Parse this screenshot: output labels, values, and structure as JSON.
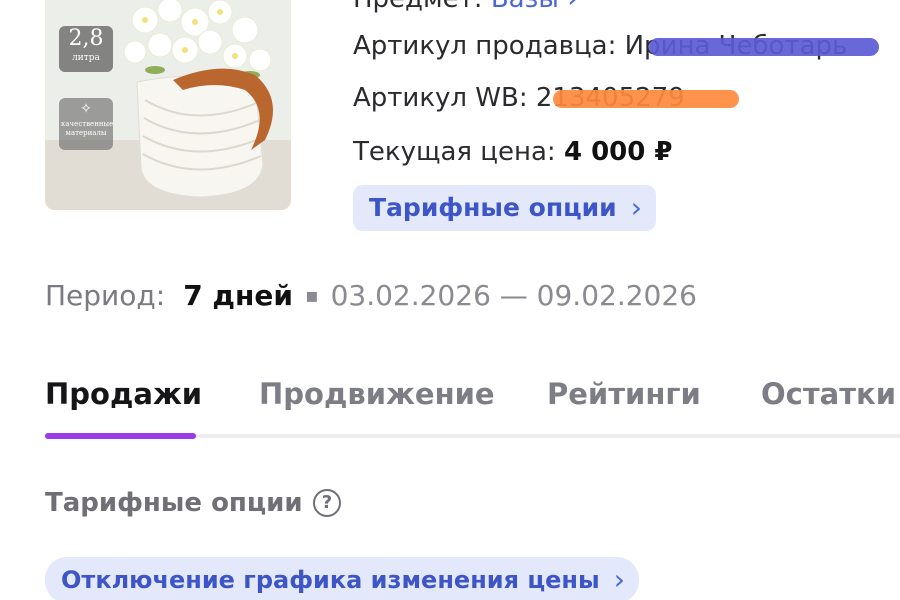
{
  "product": {
    "volume": "2,8",
    "volume_unit": "литра",
    "quality_label": "качественные материалы"
  },
  "info": {
    "subject_label": "Предмет:",
    "subject_value": "Вазы",
    "seller_article_label": "Артикул продавца:",
    "seller_article_value": "Ирина Чеботарь",
    "wb_article_label": "Артикул WB:",
    "wb_article_value": "213405279",
    "price_label": "Текущая цена:",
    "price_value": "4 000 ₽",
    "tariff_button": "Тарифные опции"
  },
  "period": {
    "label": "Период:",
    "days": "7 дней",
    "separator": "▪",
    "range": "03.02.2026 — 09.02.2026"
  },
  "tabs": [
    {
      "label": "Продажи",
      "active": true
    },
    {
      "label": "Продвижение",
      "active": false
    },
    {
      "label": "Рейтинги",
      "active": false
    },
    {
      "label": "Остатки",
      "active": false
    }
  ],
  "section": {
    "title": "Тарифные опции",
    "help": "?",
    "option_button": "Отключение графика изменения цены"
  },
  "icons": {
    "chevron": "chevron-right-icon",
    "help": "help-circle-icon"
  },
  "colors": {
    "accent_tab": "#9b3be8",
    "pill_bg": "#e3e9fb",
    "pill_text": "#3d55c7",
    "link": "#4a67d6"
  }
}
